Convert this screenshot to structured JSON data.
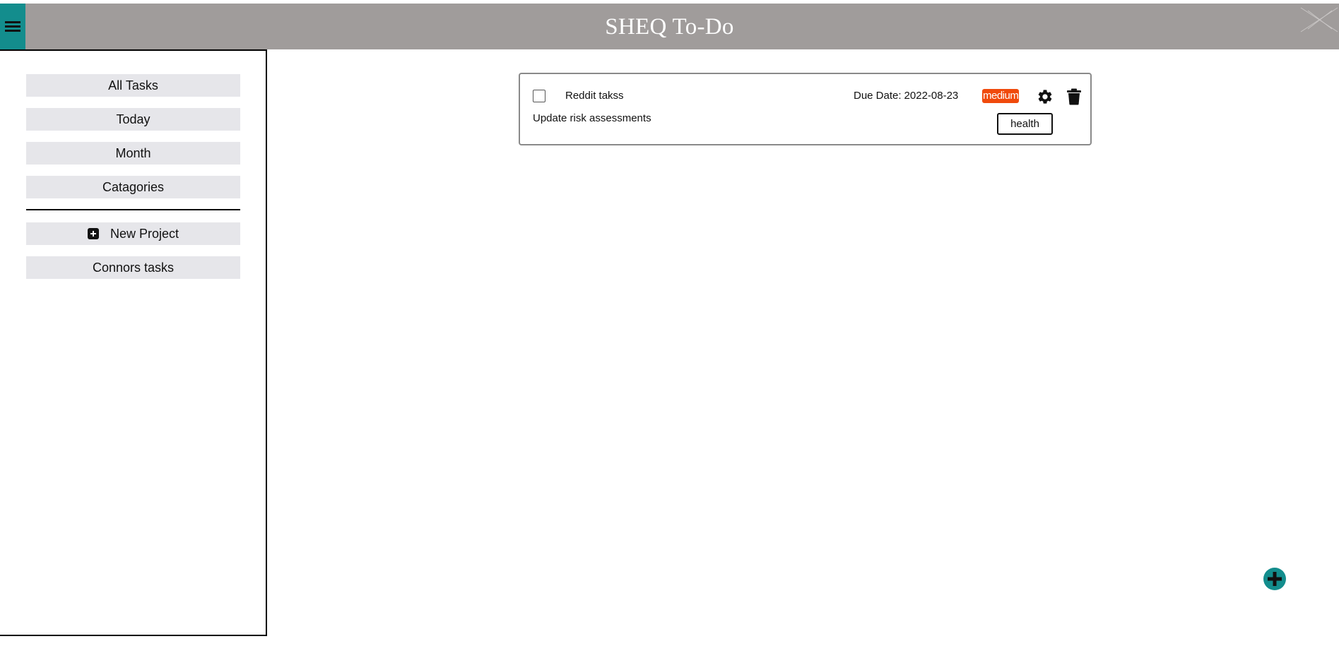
{
  "header": {
    "title": "SHEQ To-Do",
    "accent_color": "#138d8d",
    "background_color": "#a09c9b",
    "menu_icon": "hamburger-menu-icon"
  },
  "sidebar": {
    "nav_items": [
      {
        "label": "All Tasks"
      },
      {
        "label": "Today"
      },
      {
        "label": "Month"
      },
      {
        "label": "Catagories"
      }
    ],
    "new_project_label": "New Project",
    "new_project_icon": "plus-square-icon",
    "projects": [
      {
        "label": "Connors tasks"
      }
    ]
  },
  "task": {
    "title": "Reddit takss",
    "description": "Update risk assessments",
    "due_label": "Due Date:",
    "due_date": "2022-08-23",
    "priority": "medium",
    "priority_color": "#f04a0c",
    "tag": "health",
    "completed": false,
    "edit_icon": "gear-icon",
    "delete_icon": "trash-icon"
  },
  "fab": {
    "icon": "plus-circle-icon",
    "color": "#138d8d"
  }
}
